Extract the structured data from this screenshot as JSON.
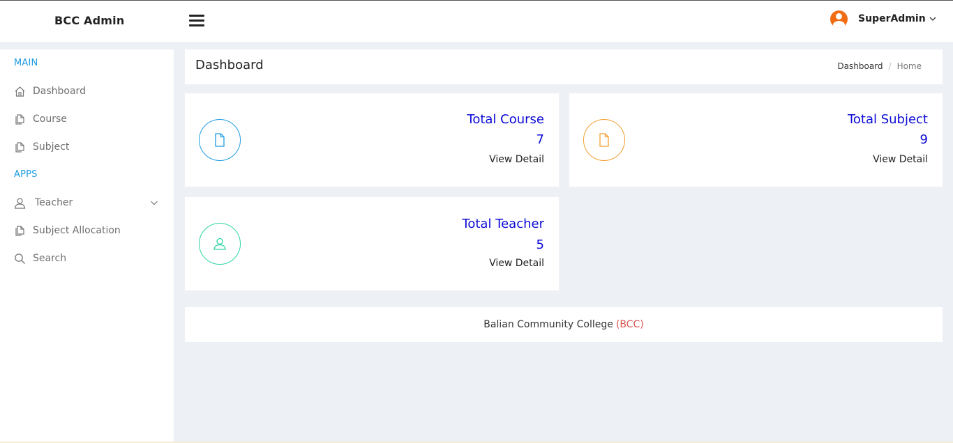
{
  "header": {
    "brand": "BCC Admin",
    "user_name": "SuperAdmin"
  },
  "sidebar": {
    "section_main": "MAIN",
    "section_apps": "APPS",
    "items": [
      {
        "label": "Dashboard",
        "icon": "home-icon"
      },
      {
        "label": "Course",
        "icon": "documents-icon"
      },
      {
        "label": "Subject",
        "icon": "documents-icon"
      },
      {
        "label": "Teacher",
        "icon": "user-icon"
      },
      {
        "label": "Subject Allocation",
        "icon": "documents-icon"
      },
      {
        "label": "Search",
        "icon": "search-icon"
      }
    ]
  },
  "page": {
    "title": "Dashboard",
    "breadcrumb": [
      "Dashboard",
      "Home"
    ]
  },
  "cards": [
    {
      "title": "Total Course",
      "count": "7",
      "link": "View Detail",
      "icon": "file-icon",
      "color": "#1e9be0"
    },
    {
      "title": "Total Subject",
      "count": "9",
      "link": "View Detail",
      "icon": "file-icon",
      "color": "#f0a030"
    },
    {
      "title": "Total Teacher",
      "count": "5",
      "link": "View Detail",
      "icon": "user-icon",
      "color": "#2fd3a6"
    }
  ],
  "footer": {
    "text": "Balian Community College",
    "abbr": "(BCC)"
  },
  "colors": {
    "accent": "#1e9be0",
    "card_value": "#0a0ad6",
    "avatar": "#f26c13",
    "footer_abbr": "#d9534f",
    "background": "#edf0f5"
  }
}
